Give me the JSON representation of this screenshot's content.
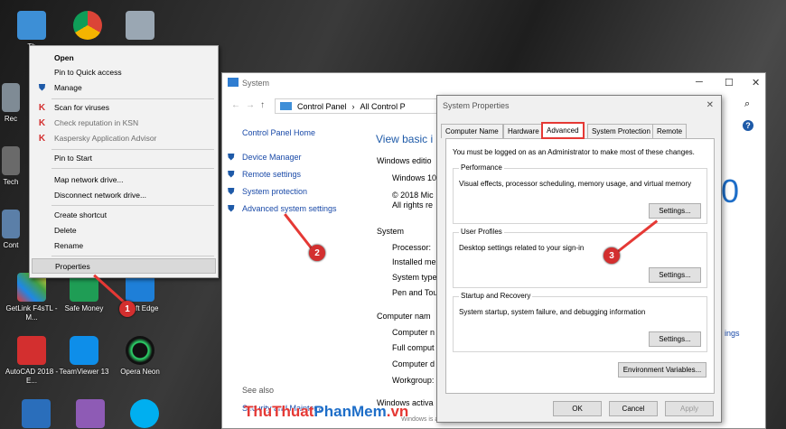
{
  "desktop": {
    "icons": [
      {
        "name": "this-pc-icon",
        "label": "Th"
      },
      {
        "name": "chrome-icon",
        "label": ""
      },
      {
        "name": "scanner-app-icon",
        "label": ""
      },
      {
        "name": "recycle-bin-icon",
        "label": "Rec"
      },
      {
        "name": "tech-icon",
        "label": "Tech"
      },
      {
        "name": "control-icon",
        "label": "Cont"
      },
      {
        "name": "getlink-icon",
        "label": "GetLink F4sTL - M..."
      },
      {
        "name": "safe-money-icon",
        "label": "Safe Money"
      },
      {
        "name": "edge-icon",
        "label": "rosoft Edge"
      },
      {
        "name": "autocad-icon",
        "label": "AutoCAD 2018 - E..."
      },
      {
        "name": "teamviewer-icon",
        "label": "TeamViewer 13"
      },
      {
        "name": "opera-neon-icon",
        "label": "Opera Neon"
      }
    ]
  },
  "context_menu": {
    "items": [
      {
        "label": "Open",
        "bold": true
      },
      {
        "label": "Pin to Quick access"
      },
      {
        "label": "Manage",
        "icon": "shield"
      },
      {
        "label": "Scan for viruses",
        "icon": "kaspersky"
      },
      {
        "label": "Check reputation in KSN",
        "icon": "kaspersky",
        "gray": true
      },
      {
        "label": "Kaspersky Application Advisor",
        "icon": "kaspersky",
        "gray": true
      },
      {
        "label": "Pin to Start"
      },
      {
        "label": "Map network drive..."
      },
      {
        "label": "Disconnect network drive..."
      },
      {
        "label": "Create shortcut"
      },
      {
        "label": "Delete"
      },
      {
        "label": "Rename"
      },
      {
        "label": "Properties",
        "highlight": true
      }
    ]
  },
  "system_window": {
    "title": "System",
    "breadcrumb": [
      "Control Panel",
      "›",
      "All Control P"
    ],
    "search_glyph": "⌕",
    "sidebar_home": "Control Panel Home",
    "links": [
      "Device Manager",
      "Remote settings",
      "System protection",
      "Advanced system settings"
    ],
    "see_also": "See also",
    "see_also_item": "Security and Maintena",
    "heading": "View basic i",
    "windows_edition": "Windows editio",
    "edition_lines": [
      "Windows 10",
      "© 2018 Mic",
      "All rights re"
    ],
    "system_label": "System",
    "system_rows": [
      "Processor:",
      "Installed me",
      "System type",
      "Pen and Tou"
    ],
    "computer_name_label": "Computer nam",
    "computer_rows": [
      "Computer n",
      "Full comput",
      "Computer d",
      "Workgroup:"
    ],
    "activation": "Windows activa",
    "big_digit": "0",
    "side_link": "ings",
    "footer_fragment": "Windows is activated   Read the Microsoft Software License Terms"
  },
  "dialog": {
    "title": "System Properties",
    "close_glyph": "✕",
    "tabs": [
      "Computer Name",
      "Hardware",
      "Advanced",
      "System Protection",
      "Remote"
    ],
    "active_tab": "Advanced",
    "admin_note": "You must be logged on as an Administrator to make most of these changes.",
    "performance": {
      "title": "Performance",
      "desc": "Visual effects, processor scheduling, memory usage, and virtual memory",
      "button": "Settings..."
    },
    "profiles": {
      "title": "User Profiles",
      "desc": "Desktop settings related to your sign-in",
      "button": "Settings..."
    },
    "startup": {
      "title": "Startup and Recovery",
      "desc": "System startup, system failure, and debugging information",
      "button": "Settings..."
    },
    "env_button": "Environment Variables...",
    "ok": "OK",
    "cancel": "Cancel",
    "apply": "Apply"
  },
  "markers": [
    "1",
    "2",
    "3"
  ],
  "watermark": {
    "part1": "ThuThuat",
    "part2": "PhanMem",
    "part3": ".vn"
  },
  "colors": {
    "accent": "#e53935",
    "link": "#1a4aa8"
  }
}
